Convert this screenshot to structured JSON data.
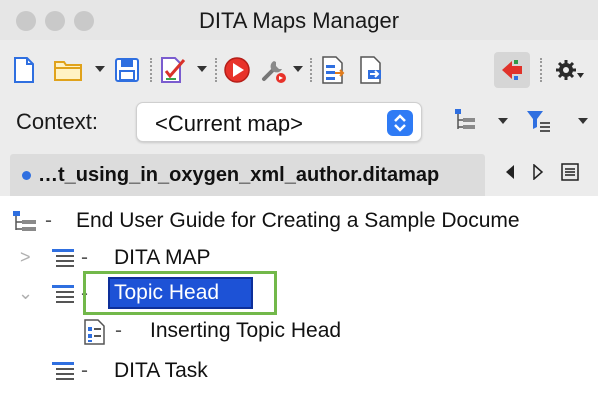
{
  "window": {
    "title": "DITA Maps Manager"
  },
  "toolbar": {
    "icons": [
      "new-file-icon",
      "open-folder-icon",
      "save-icon",
      "validate-icon",
      "apply-transformation-icon",
      "configure-transformation-icon",
      "export-map-icon",
      "open-map-in-editor-icon",
      "link-with-editor-icon",
      "settings-icon"
    ]
  },
  "context": {
    "label": "Context:",
    "value": "<Current map>"
  },
  "tab": {
    "label": "…t_using_in_oxygen_xml_author.ditamap"
  },
  "tree": {
    "root": {
      "label": "End User Guide for Creating a Sample Docume",
      "dash": "-"
    },
    "items": [
      {
        "label": "DITA MAP",
        "dash": "-",
        "expander": ">"
      },
      {
        "label": "Topic Head",
        "dash": "-",
        "expander": "⌄",
        "selected": true
      },
      {
        "label": "Inserting Topic Head",
        "dash": "-"
      },
      {
        "label": "DITA Task",
        "dash": "-"
      }
    ]
  },
  "colors": {
    "selection": "#1d52d6",
    "highlight_border": "#72b84a",
    "accent": "#2f7bf5"
  }
}
